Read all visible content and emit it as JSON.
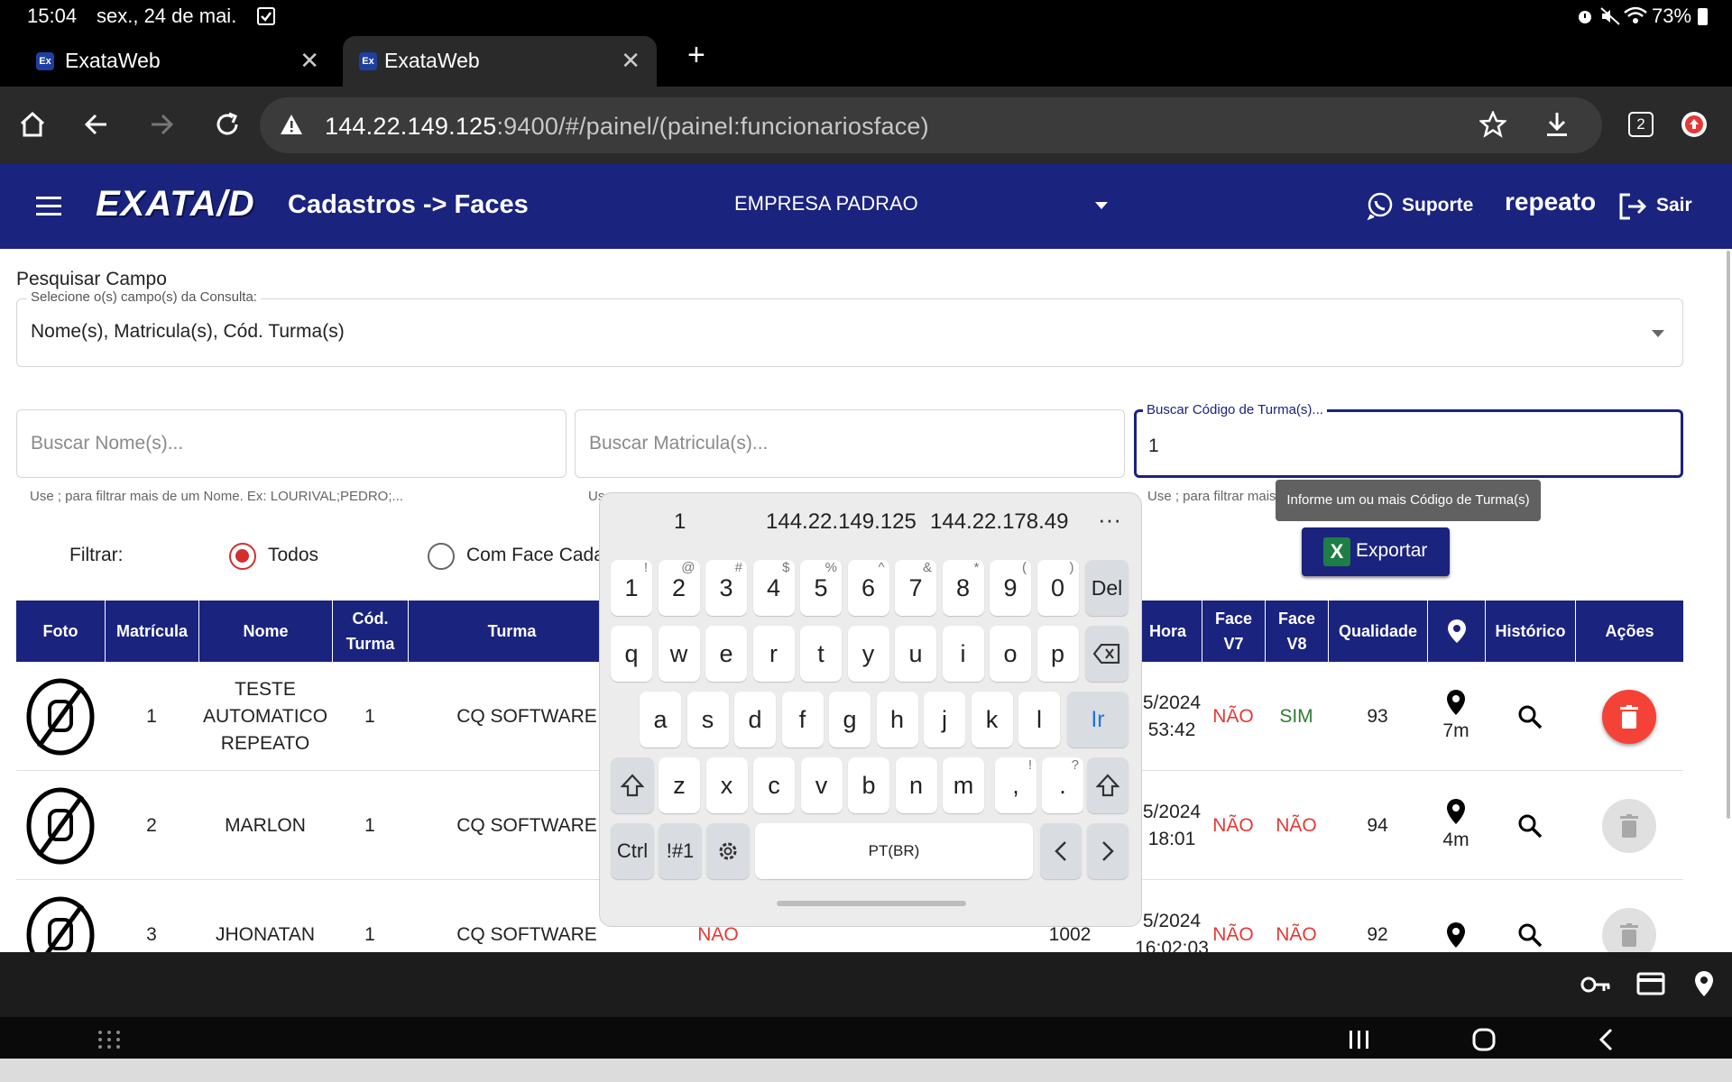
{
  "status_bar": {
    "time": "15:04",
    "date": "sex., 24 de mai.",
    "battery": "73%"
  },
  "browser": {
    "tabs": [
      {
        "title": "ExataWeb",
        "favicon": "Ex"
      },
      {
        "title": "ExataWeb",
        "favicon": "Ex"
      }
    ],
    "url_host": "144.22.149.125",
    "url_rest": ":9400/#/painel/(painel:funcionariosface)",
    "tab_count": "2"
  },
  "app": {
    "logo": "EXATA/D",
    "breadcrumb": "Cadastros -> Faces",
    "company": "EMPRESA PADRAO",
    "support_label": "Suporte",
    "username": "repeato",
    "logout_label": "Sair"
  },
  "search": {
    "section_title": "Pesquisar Campo",
    "fields_label": "Selecione o(s) campo(s) da Consulta:",
    "fields_value": "Nome(s), Matricula(s), Cód. Turma(s)",
    "name_placeholder": "Buscar Nome(s)...",
    "name_hint": "Use ; para filtrar mais de um Nome. Ex: LOURIVAL;PEDRO;...",
    "matricula_placeholder": "Buscar Matricula(s)...",
    "matricula_hint": "Us",
    "turma_label": "Buscar Código de Turma(s)...",
    "turma_value": "1",
    "turma_hint": "Use ; para filtrar mais",
    "tooltip": "Informe um ou mais Código de Turma(s)"
  },
  "filter": {
    "label": "Filtrar:",
    "options": [
      {
        "label": "Todos",
        "selected": true
      },
      {
        "label": "Com Face Cada",
        "selected": false
      }
    ],
    "export_label": "Exportar"
  },
  "table": {
    "headers": {
      "foto": "Foto",
      "matricula": "Matrícula",
      "nome": "Nome",
      "cod_turma": "Cód. Turma",
      "turma": "Turma",
      "hora": "Hora",
      "face_v7": "Face V7",
      "face_v8": "Face V8",
      "qualidade": "Qualidade",
      "historico": "Histórico",
      "acoes": "Ações"
    },
    "rows": [
      {
        "matricula": "1",
        "nome": "TESTE AUTOMATICO REPEATO",
        "cod_turma": "1",
        "turma": "CQ SOFTWARE",
        "hora1": "5/2024",
        "hora2": "53:42",
        "face_v7": "NÃO",
        "face_v8": "SIM",
        "qualidade": "93",
        "location": "7m",
        "delete_enabled": true
      },
      {
        "matricula": "2",
        "nome": "MARLON",
        "cod_turma": "1",
        "turma": "CQ SOFTWARE",
        "hora1": "5/2024",
        "hora2": "18:01",
        "face_v7": "NÃO",
        "face_v8": "NÃO",
        "qualidade": "94",
        "location": "4m",
        "delete_enabled": false
      },
      {
        "matricula": "3",
        "nome": "JHONATAN",
        "cod_turma": "1",
        "turma": "CQ SOFTWARE",
        "extra_col": "NAO",
        "codigo": "1002",
        "hora1": "5/2024",
        "hora2": "16:02:03",
        "face_v7": "NÃO",
        "face_v8": "NÃO",
        "qualidade": "92",
        "location": "",
        "delete_enabled": false
      }
    ]
  },
  "keyboard": {
    "suggestions": [
      "1",
      "144.22.149.125",
      "144.22.178.49"
    ],
    "row1": [
      {
        "k": "1",
        "s": "!"
      },
      {
        "k": "2",
        "s": "@"
      },
      {
        "k": "3",
        "s": "#"
      },
      {
        "k": "4",
        "s": "$"
      },
      {
        "k": "5",
        "s": "%"
      },
      {
        "k": "6",
        "s": "^"
      },
      {
        "k": "7",
        "s": "&"
      },
      {
        "k": "8",
        "s": "*"
      },
      {
        "k": "9",
        "s": "("
      },
      {
        "k": "0",
        "s": ")"
      }
    ],
    "del_label": "Del",
    "row2": [
      "q",
      "w",
      "e",
      "r",
      "t",
      "y",
      "u",
      "i",
      "o",
      "p"
    ],
    "row3": [
      "a",
      "s",
      "d",
      "f",
      "g",
      "h",
      "j",
      "k",
      "l"
    ],
    "go_label": "Ir",
    "row4": [
      "z",
      "x",
      "c",
      "v",
      "b",
      "n",
      "m"
    ],
    "comma": ",",
    "comma_sup": "!",
    "period": ".",
    "period_sup": "?",
    "ctrl_label": "Ctrl",
    "symbols_label": "!#1",
    "space_label": "PT(BR)"
  },
  "colors": {
    "primary": "#1a237e",
    "danger": "#f44336",
    "success": "#2e7d32"
  }
}
